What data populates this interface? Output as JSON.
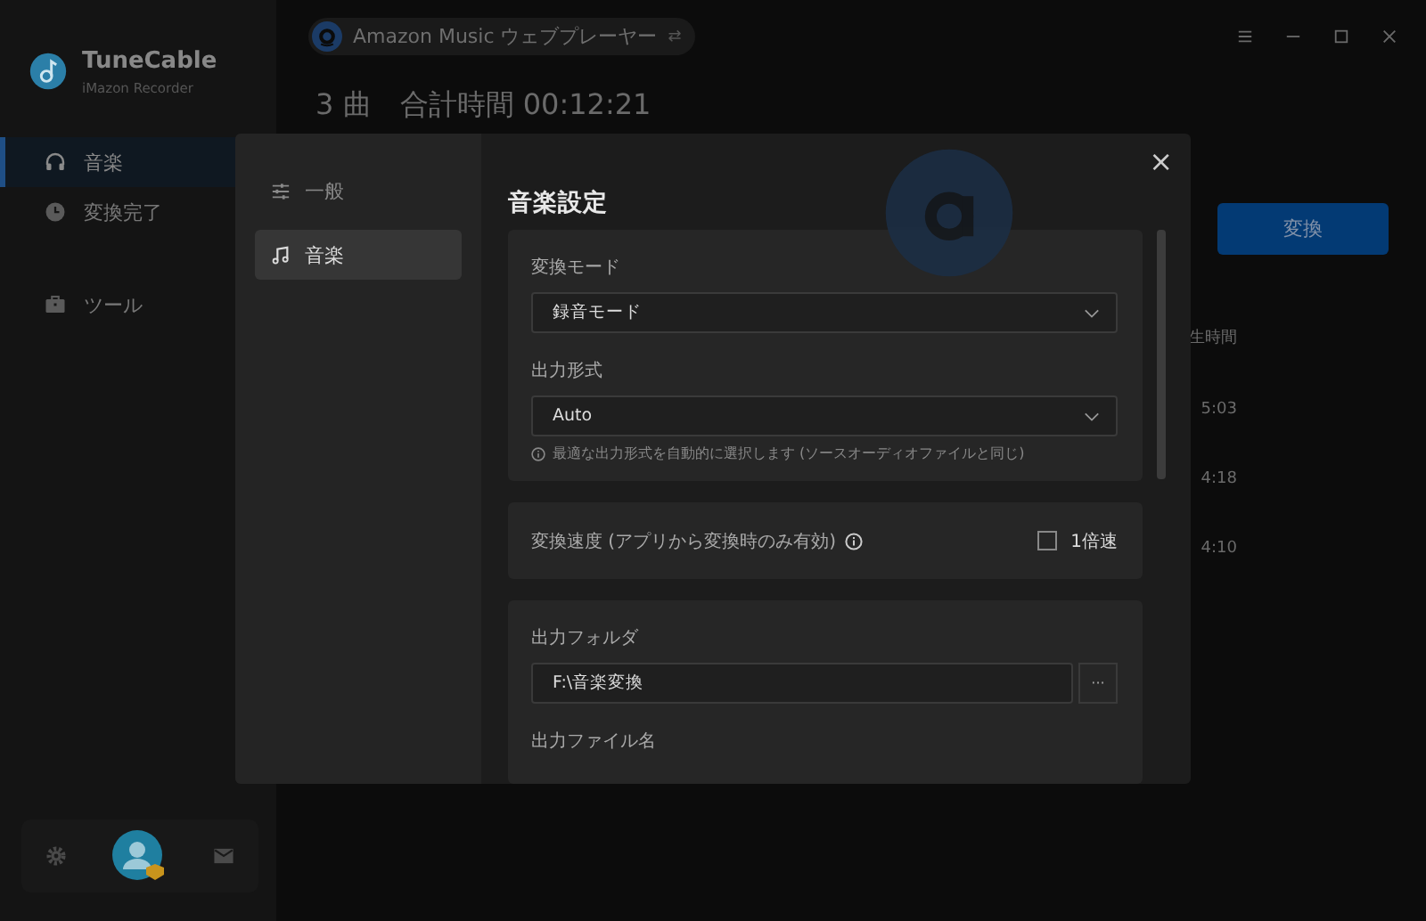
{
  "app": {
    "name": "TuneCable",
    "subtitle": "iMazon Recorder"
  },
  "sidebar": {
    "items": [
      {
        "label": "音楽",
        "selected": true
      },
      {
        "label": "変換完了",
        "selected": false
      },
      {
        "label": "ツール",
        "selected": false
      }
    ]
  },
  "source": {
    "label": "Amazon Music ウェブプレーヤー",
    "switch": "⇄"
  },
  "main": {
    "summary": "3 曲　合計時間 00:12:21",
    "convert_button": "変換",
    "column_header": "生時間",
    "durations": [
      "5:03",
      "4:18",
      "4:10"
    ]
  },
  "settings": {
    "close": "×",
    "nav": [
      {
        "label": "一般",
        "selected": false
      },
      {
        "label": "音楽",
        "selected": true
      }
    ],
    "title": "音楽設定",
    "mode": {
      "label": "変換モード",
      "value": "録音モード"
    },
    "format": {
      "label": "出力形式",
      "value": "Auto",
      "hint": "最適な出力形式を自動的に選択します (ソースオーディオファイルと同じ)"
    },
    "speed": {
      "label": "変換速度 (アプリから変換時のみ有効)",
      "option": "1倍速",
      "checked": false
    },
    "folder": {
      "label": "出力フォルダ",
      "value": "F:\\音楽変換",
      "browse": "···"
    },
    "filename": {
      "label": "出力ファイル名"
    }
  }
}
